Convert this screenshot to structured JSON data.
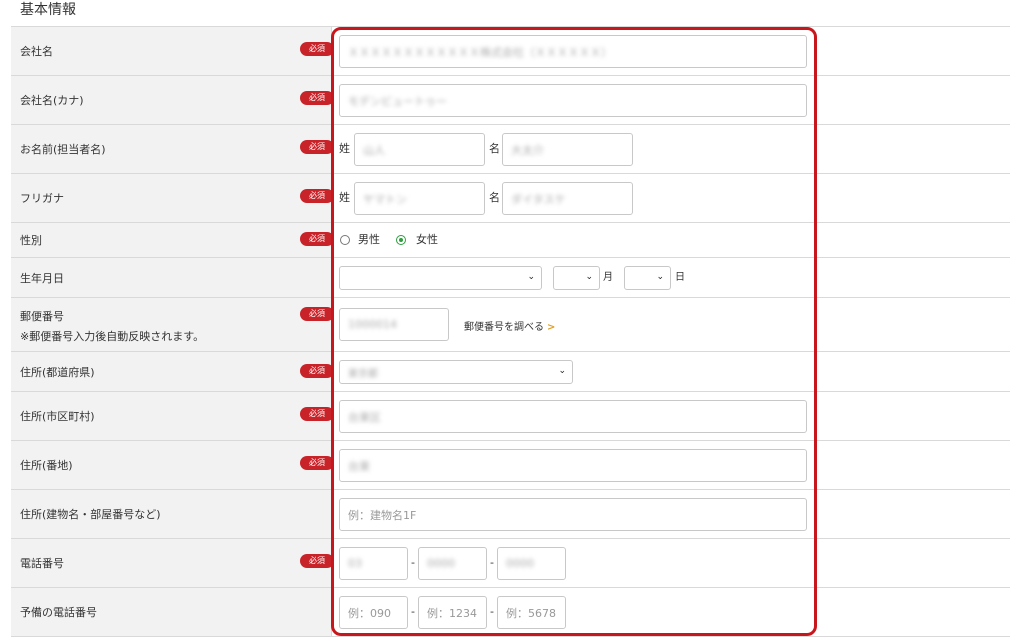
{
  "section_title": "基本情報",
  "required_label": "必須",
  "rows": {
    "company": {
      "label": "会社名",
      "value": "ＸＸＸＸＸＸＸＸＸＸＸＸ株式会社（ＸＸＸＸＸＸ）"
    },
    "company_kana": {
      "label": "会社名(カナ)",
      "value": "モデンビュートゥー"
    },
    "name": {
      "label": "お名前(担当者名)",
      "sei_label": "姓",
      "mei_label": "名",
      "sei_value": "山人",
      "mei_value": "大太介"
    },
    "furigana": {
      "label": "フリガナ",
      "sei_label": "姓",
      "mei_label": "名",
      "sei_value": "ヤマトン",
      "mei_value": "ダイタスケ"
    },
    "gender": {
      "label": "性別",
      "options": [
        "男性",
        "女性"
      ],
      "selected": "女性"
    },
    "birthdate": {
      "label": "生年月日",
      "month_suffix": "月",
      "day_suffix": "日"
    },
    "postal": {
      "label": "郵便番号",
      "note": "※郵便番号入力後自動反映されます。",
      "value": "1000014",
      "lookup_link": "郵便番号を調べる"
    },
    "prefecture": {
      "label": "住所(都道府県)",
      "value": "東京都"
    },
    "city": {
      "label": "住所(市区町村)",
      "value": "台東区"
    },
    "street": {
      "label": "住所(番地)",
      "value": "台東"
    },
    "building": {
      "label": "住所(建物名・部屋番号など)",
      "placeholder": "例：建物名1F"
    },
    "phone": {
      "label": "電話番号",
      "part1": "03",
      "part2": "0000",
      "part3": "0000",
      "separator": "-"
    },
    "phone_alt": {
      "label": "予備の電話番号",
      "placeholder1": "例：090",
      "placeholder2": "例：1234",
      "placeholder3": "例：5678",
      "separator": "-"
    }
  },
  "colors": {
    "required_badge": "#c9232a",
    "highlight_border": "#c8161d",
    "label_bg": "#f2f2f2",
    "radio_selected": "#2e9e3e",
    "link_arrow": "#e0a020"
  }
}
